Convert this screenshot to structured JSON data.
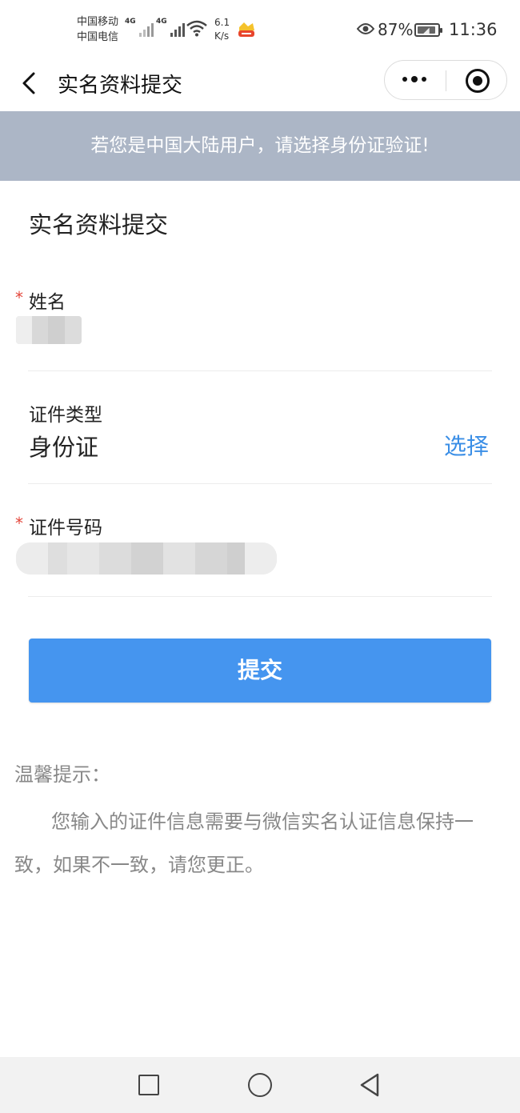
{
  "status_bar": {
    "carrier_1": "中国移动",
    "carrier_2": "中国电信",
    "network_1": "4G",
    "network_2": "4G",
    "speed_value": "6.1",
    "speed_unit": "K/s",
    "battery_percent": "87%",
    "time": "11:36",
    "icons": [
      "signal-icon",
      "wifi-icon",
      "app-badge-icon",
      "eye-icon",
      "battery-icon"
    ]
  },
  "nav": {
    "title": "实名资料提交",
    "icons": [
      "back-arrow-icon",
      "more-icon",
      "close-target-icon"
    ]
  },
  "notice": {
    "text": "若您是中国大陆用户，请选择身份证验证!"
  },
  "form": {
    "section_title": "实名资料提交",
    "name_field": {
      "label": "姓名",
      "required_mark": "*"
    },
    "id_type_field": {
      "label": "证件类型",
      "value": "身份证",
      "action": "选择"
    },
    "id_number_field": {
      "label": "证件号码",
      "required_mark": "*"
    },
    "submit_label": "提交"
  },
  "tips": {
    "title": "温馨提示：",
    "body": "您输入的证件信息需要与微信实名认证信息保持一致，如果不一致，请您更正。"
  },
  "colors": {
    "notice_bg": "#acb6c6",
    "primary": "#4595ef",
    "link": "#3a8ee6",
    "required": "#e3463b",
    "tip_text": "#888888"
  },
  "system_nav": {
    "icons": [
      "recent-apps-icon",
      "home-icon",
      "back-icon"
    ]
  }
}
